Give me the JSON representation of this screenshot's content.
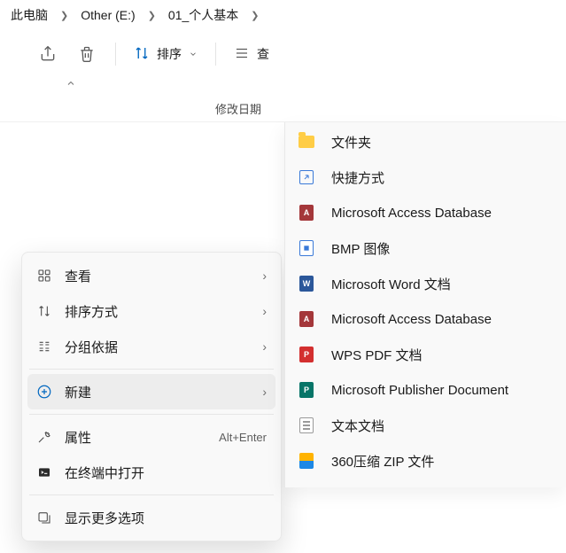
{
  "breadcrumb": {
    "items": [
      "此电脑",
      "Other (E:)",
      "01_个人基本"
    ]
  },
  "toolbar": {
    "sort_label": "排序",
    "view_label": "查"
  },
  "columns": {
    "date": "修改日期"
  },
  "ctx": {
    "view": "查看",
    "sort": "排序方式",
    "group": "分组依据",
    "new": "新建",
    "props": "属性",
    "props_accel": "Alt+Enter",
    "terminal": "在终端中打开",
    "more": "显示更多选项"
  },
  "new_sub": {
    "folder": "文件夹",
    "shortcut": "快捷方式",
    "access1": "Microsoft Access Database",
    "bmp": "BMP 图像",
    "word": "Microsoft Word 文档",
    "access2": "Microsoft Access Database",
    "pdf": "WPS PDF 文档",
    "pub": "Microsoft Publisher Document",
    "txt": "文本文档",
    "zip": "360压缩 ZIP 文件"
  }
}
